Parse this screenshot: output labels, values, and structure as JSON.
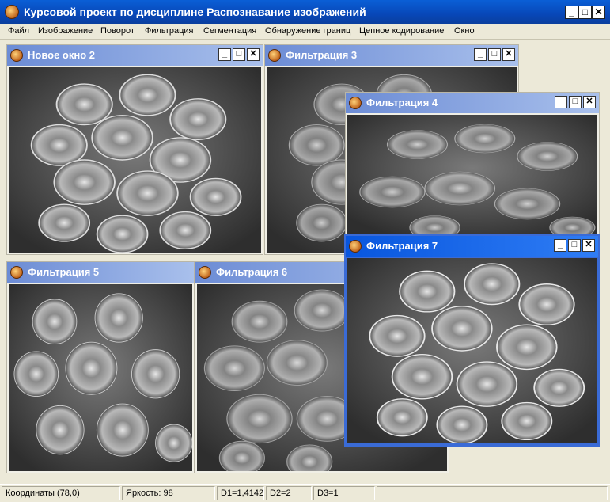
{
  "app": {
    "title": "Курсовой проект по дисциплине Распознавание изображений"
  },
  "window_buttons": {
    "minimize": "_",
    "maximize": "□",
    "close": "✕"
  },
  "menu": [
    "Файл",
    "Изображение",
    "Поворот",
    "Фильтрация",
    "Сегментация",
    "Обнаружение границ",
    "Цепное кодирование",
    "Окно"
  ],
  "windows": [
    {
      "title": "Новое окно 2"
    },
    {
      "title": "Фильтрация 3"
    },
    {
      "title": "Фильтрация 4"
    },
    {
      "title": "Фильтрация 5"
    },
    {
      "title": "Фильтрация 6"
    },
    {
      "title": "Фильтрация 7"
    }
  ],
  "status": {
    "coords": "Координаты (78,0)",
    "brightness": "Яркость: 98",
    "d1": "D1=1,4142",
    "d2": "D2=2",
    "d3": "D3=1"
  },
  "colors": {
    "title_active": "#0856de",
    "title_inactive": "#7b97d9",
    "menu_bg": "#ece9d8"
  },
  "icons": [
    "app-icon",
    "minimize-icon",
    "maximize-icon",
    "close-icon"
  ]
}
